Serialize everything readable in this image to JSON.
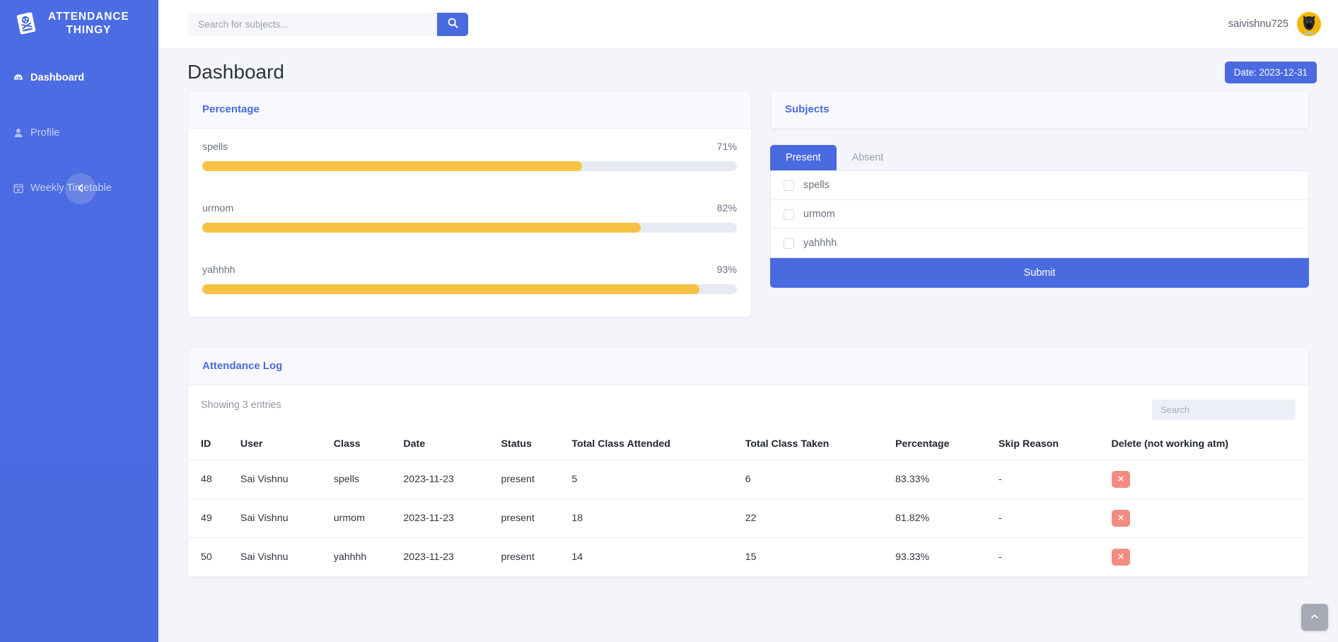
{
  "sidebar": {
    "brand": {
      "line1": "ATTENDANCE",
      "line2": "THINGY",
      "icon": "skull-book-icon"
    },
    "items": [
      {
        "label": "Dashboard",
        "icon": "gauge-icon",
        "active": true
      },
      {
        "label": "Profile",
        "icon": "user-icon",
        "active": false
      },
      {
        "label": "Weekly Timetable",
        "icon": "calendar-x-icon",
        "active": false
      }
    ],
    "collapse_icon": "chevron-left-icon"
  },
  "topbar": {
    "search": {
      "placeholder": "Search for subjects...",
      "value": "",
      "button_icon": "search-icon"
    },
    "username": "saivishnu725",
    "avatar_icon": "user-avatar-dog"
  },
  "page": {
    "title": "Dashboard",
    "date_badge": "Date: 2023-12-31"
  },
  "percentage_card": {
    "title": "Percentage",
    "bars": [
      {
        "name": "spells",
        "value": 71,
        "display": "71%"
      },
      {
        "name": "urmom",
        "value": 82,
        "display": "82%"
      },
      {
        "name": "yahhhh",
        "value": 93,
        "display": "93%"
      }
    ],
    "fill_color": "#f5c243",
    "track_color": "#e8eaf2"
  },
  "subjects_card": {
    "title": "Subjects",
    "tabs": [
      {
        "label": "Present",
        "active": true
      },
      {
        "label": "Absent",
        "active": false
      }
    ],
    "items": [
      {
        "label": "spells",
        "checked": false
      },
      {
        "label": "urmom",
        "checked": false
      },
      {
        "label": "yahhhh",
        "checked": false
      }
    ],
    "submit_label": "Submit"
  },
  "log_card": {
    "title": "Attendance Log",
    "entries_text": "Showing 3 entries",
    "search": {
      "placeholder": "Search",
      "value": ""
    },
    "columns": [
      "ID",
      "User",
      "Class",
      "Date",
      "Status",
      "Total Class Attended",
      "Total Class Taken",
      "Percentage",
      "Skip Reason",
      "Delete (not working atm)"
    ],
    "rows": [
      {
        "id": "48",
        "user": "Sai Vishnu",
        "class": "spells",
        "date": "2023-11-23",
        "status": "present",
        "attended": "5",
        "taken": "6",
        "percentage": "83.33%",
        "skip_reason": "-",
        "delete_icon": "close-icon"
      },
      {
        "id": "49",
        "user": "Sai Vishnu",
        "class": "urmom",
        "date": "2023-11-23",
        "status": "present",
        "attended": "18",
        "taken": "22",
        "percentage": "81.82%",
        "skip_reason": "-",
        "delete_icon": "close-icon"
      },
      {
        "id": "50",
        "user": "Sai Vishnu",
        "class": "yahhhh",
        "date": "2023-11-23",
        "status": "present",
        "attended": "14",
        "taken": "15",
        "percentage": "93.33%",
        "skip_reason": "-",
        "delete_icon": "close-icon"
      }
    ]
  },
  "scroll_top": {
    "icon": "chevron-up-icon"
  },
  "colors": {
    "primary": "#4a6ae0",
    "accent_yellow": "#f5c243",
    "danger": "#f28b82",
    "page_bg": "#f4f5fa",
    "avatar_bg": "#f2b705"
  }
}
